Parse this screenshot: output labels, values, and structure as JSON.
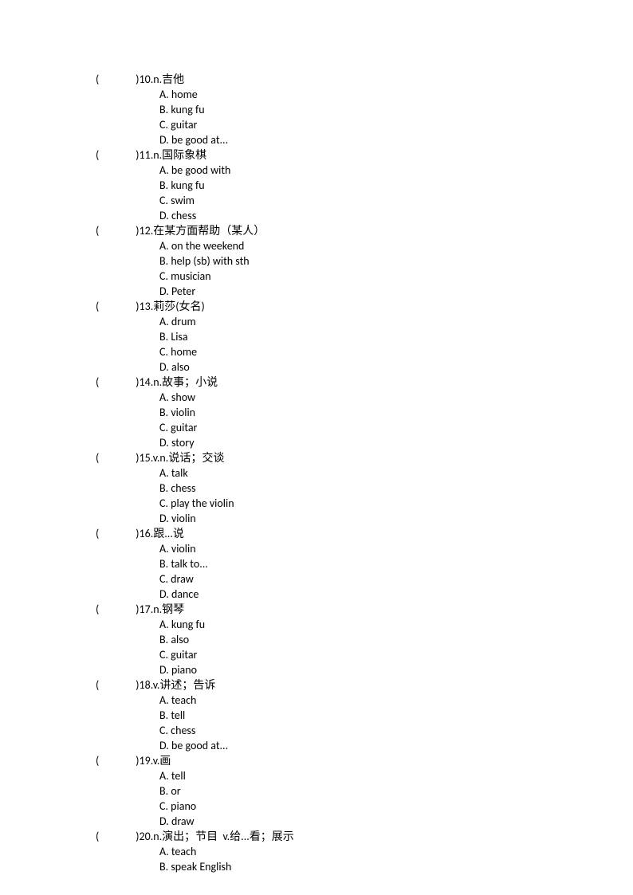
{
  "questions": [
    {
      "number": "10",
      "prompt": "n.吉他",
      "options": [
        "A. home",
        "B. kung fu",
        "C. guitar",
        "D. be good at..."
      ]
    },
    {
      "number": "11",
      "prompt": "n.国际象棋",
      "options": [
        "A. be good with",
        "B. kung fu",
        "C. swim",
        "D. chess"
      ]
    },
    {
      "number": "12",
      "prompt": "在某方面帮助（某人）",
      "options": [
        "A. on the weekend",
        "B. help (sb) with sth",
        "C. musician",
        "D. Peter"
      ]
    },
    {
      "number": "13",
      "prompt": "莉莎(女名)",
      "options": [
        "A. drum",
        "B. Lisa",
        "C. home",
        "D. also"
      ]
    },
    {
      "number": "14",
      "prompt": "n.故事；小说",
      "options": [
        "A. show",
        "B. violin",
        "C. guitar",
        "D. story"
      ]
    },
    {
      "number": "15",
      "prompt": "v.n.说话；交谈",
      "options": [
        "A. talk",
        "B. chess",
        "C. play the violin",
        "D. violin"
      ]
    },
    {
      "number": "16",
      "prompt": "跟...说",
      "options": [
        "A. violin",
        "B. talk to...",
        "C. draw",
        "D. dance"
      ]
    },
    {
      "number": "17",
      "prompt": "n.钢琴",
      "options": [
        "A. kung fu",
        "B. also",
        "C. guitar",
        "D. piano"
      ]
    },
    {
      "number": "18",
      "prompt": "v.讲述；告诉",
      "options": [
        "A. teach",
        "B. tell",
        "C. chess",
        "D. be good at..."
      ]
    },
    {
      "number": "19",
      "prompt": "v.画",
      "options": [
        "A. tell",
        "B. or",
        "C. piano",
        "D. draw"
      ]
    },
    {
      "number": "20",
      "prompt": "n.演出；节目  v.给...看；展示",
      "options": [
        "A. teach",
        "B. speak English"
      ]
    }
  ]
}
